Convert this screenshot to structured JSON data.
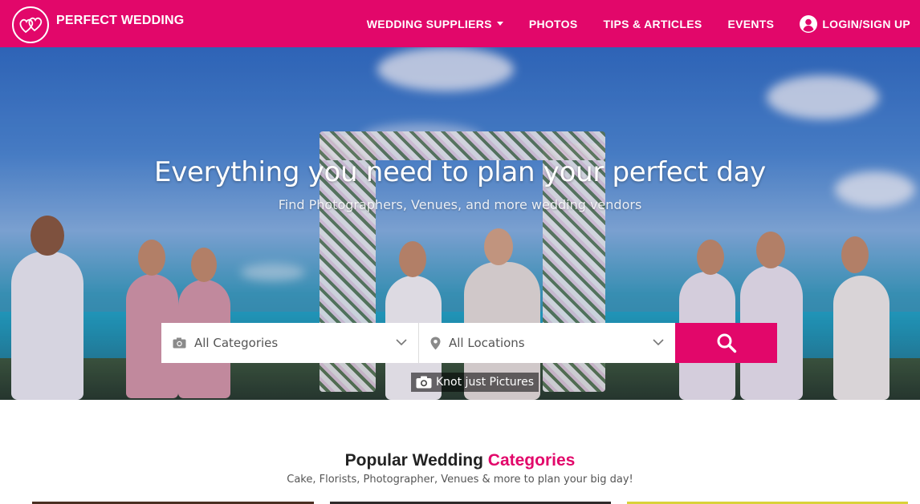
{
  "brand": {
    "name": "PERFECT WEDDING",
    "logo_icon": "interlocked-hearts-icon"
  },
  "nav": {
    "items": [
      {
        "label": "WEDDING SUPPLIERS",
        "has_dropdown": true
      },
      {
        "label": "PHOTOS"
      },
      {
        "label": "TIPS & ARTICLES"
      },
      {
        "label": "EVENTS"
      }
    ],
    "login_label": "LOGIN/SIGN UP",
    "login_icon": "user-circle-icon"
  },
  "hero": {
    "title": "Everything you need to plan your perfect day",
    "subtitle": "Find Photographers, Venues, and more wedding vendors",
    "caption": "Knot just Pictures",
    "caption_icon": "camera-icon"
  },
  "search": {
    "category": {
      "value": "All Categories",
      "icon": "camera-icon"
    },
    "location": {
      "value": "All Locations",
      "icon": "map-pin-icon"
    },
    "button_icon": "search-icon"
  },
  "popular": {
    "title_main": "Popular Wedding",
    "title_accent": "Categories",
    "subtitle": "Cake, Florists, Photographer, Venues & more to plan your big day!"
  },
  "colors": {
    "brand": "#e2076a",
    "white": "#ffffff"
  }
}
